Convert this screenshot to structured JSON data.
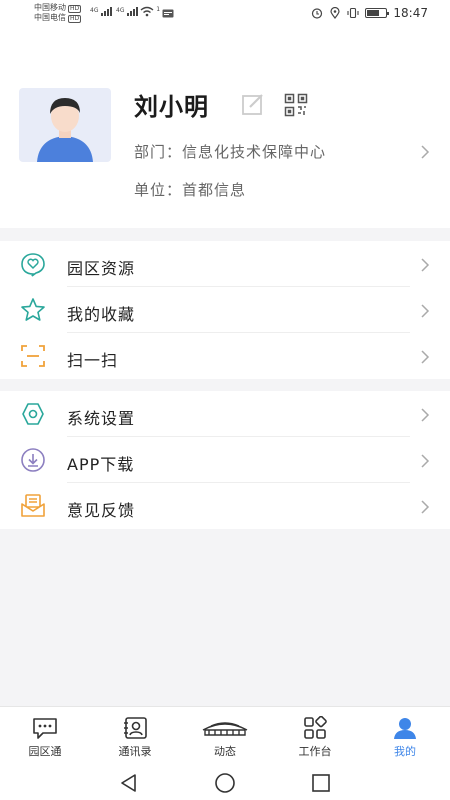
{
  "status_bar": {
    "carrier1": "中国移动",
    "carrier2": "中国电信",
    "hd": "HD",
    "net": "4G",
    "wifi_num": "1",
    "time": "18:47"
  },
  "profile": {
    "name": "刘小明",
    "department": "部门：信息化技术保障中心",
    "unit": "单位：首都信息"
  },
  "menu_group1": [
    {
      "label": "园区资源",
      "icon": "heart-chat-icon"
    },
    {
      "label": "我的收藏",
      "icon": "star-icon"
    },
    {
      "label": "扫一扫",
      "icon": "scan-icon"
    }
  ],
  "menu_group2": [
    {
      "label": "系统设置",
      "icon": "gear-icon"
    },
    {
      "label": "APP下载",
      "icon": "download-icon"
    },
    {
      "label": "意见反馈",
      "icon": "feedback-icon"
    }
  ],
  "tabs": [
    {
      "label": "园区通",
      "icon": "chat-icon",
      "active": false
    },
    {
      "label": "通讯录",
      "icon": "contacts-icon",
      "active": false
    },
    {
      "label": "动态",
      "icon": "stadium-icon",
      "active": false
    },
    {
      "label": "工作台",
      "icon": "grid-icon",
      "active": false
    },
    {
      "label": "我的",
      "icon": "user-icon",
      "active": true
    }
  ],
  "colors": {
    "accent": "#3f86e8",
    "teal": "#2aa79b",
    "orange": "#f0a23a"
  }
}
